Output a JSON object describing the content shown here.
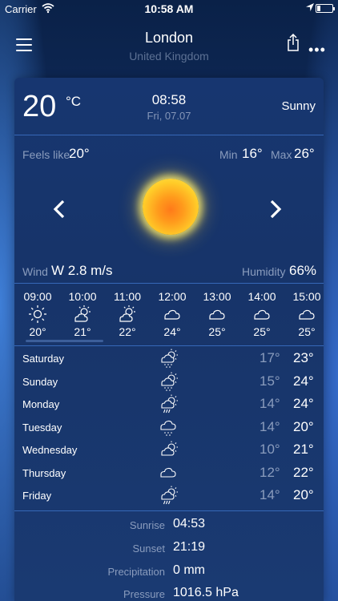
{
  "status": {
    "carrier": "Carrier",
    "time": "10:58 AM"
  },
  "header": {
    "city": "London",
    "country": "United Kingdom"
  },
  "current": {
    "temp": "20",
    "unit": "°C",
    "time": "08:58",
    "date": "Fri, 07.07",
    "condition": "Sunny",
    "feels_label": "Feels like",
    "feels_value": "20°",
    "min_label": "Min",
    "min_value": "16°",
    "max_label": "Max",
    "max_value": "26°",
    "wind_label": "Wind",
    "wind_value": "W  2.8 m/s",
    "humidity_label": "Humidity",
    "humidity_value": "66%"
  },
  "hourly": [
    {
      "time": "09:00",
      "icon": "sun-icon",
      "temp": "20°"
    },
    {
      "time": "10:00",
      "icon": "partly-sunny-icon",
      "temp": "21°"
    },
    {
      "time": "11:00",
      "icon": "partly-sunny-icon",
      "temp": "22°"
    },
    {
      "time": "12:00",
      "icon": "cloud-icon",
      "temp": "24°"
    },
    {
      "time": "13:00",
      "icon": "cloud-icon",
      "temp": "25°"
    },
    {
      "time": "14:00",
      "icon": "cloud-icon",
      "temp": "25°"
    },
    {
      "time": "15:00",
      "icon": "cloud-icon",
      "temp": "25°"
    }
  ],
  "daily": [
    {
      "day": "Saturday",
      "icon": "sun-cloud-drizzle-icon",
      "min": "17°",
      "max": "23°"
    },
    {
      "day": "Sunday",
      "icon": "sun-cloud-drizzle-icon",
      "min": "15°",
      "max": "24°"
    },
    {
      "day": "Monday",
      "icon": "sun-cloud-rain-icon",
      "min": "14°",
      "max": "24°"
    },
    {
      "day": "Tuesday",
      "icon": "cloud-drizzle-icon",
      "min": "14°",
      "max": "20°"
    },
    {
      "day": "Wednesday",
      "icon": "partly-sunny-icon",
      "min": "10°",
      "max": "21°"
    },
    {
      "day": "Thursday",
      "icon": "cloud-icon",
      "min": "12°",
      "max": "22°"
    },
    {
      "day": "Friday",
      "icon": "sun-cloud-rain-icon",
      "min": "14°",
      "max": "20°"
    }
  ],
  "details": [
    {
      "label": "Sunrise",
      "value": "04:53"
    },
    {
      "label": "Sunset",
      "value": "21:19"
    },
    {
      "label": "Precipitation",
      "value": "0 mm"
    },
    {
      "label": "Pressure",
      "value": "1016.5 hPa"
    }
  ]
}
